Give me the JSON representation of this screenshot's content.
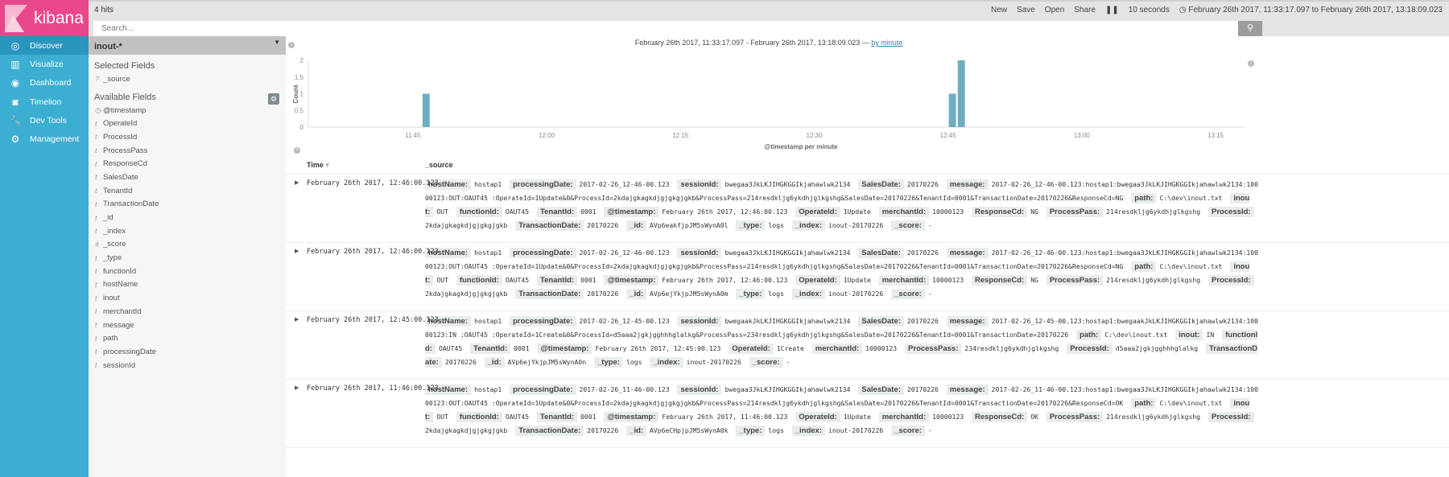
{
  "app": {
    "logo_text": "kibana"
  },
  "nav": [
    {
      "label": "Discover",
      "icon": "compass-icon",
      "glyph": "◎"
    },
    {
      "label": "Visualize",
      "icon": "bar-chart-icon",
      "glyph": "▥"
    },
    {
      "label": "Dashboard",
      "icon": "dashboard-icon",
      "glyph": "◉"
    },
    {
      "label": "Timelion",
      "icon": "timelion-icon",
      "glyph": "◙"
    },
    {
      "label": "Dev Tools",
      "icon": "wrench-icon",
      "glyph": "🔧"
    },
    {
      "label": "Management",
      "icon": "gear-icon",
      "glyph": "⚙"
    }
  ],
  "topbar": {
    "hits": "4 hits",
    "menu": [
      "New",
      "Save",
      "Open",
      "Share"
    ],
    "pause_glyph": "❚❚",
    "refresh": "10 seconds",
    "time_range": "February 26th 2017, 11:33:17.097 to February 26th 2017, 13:18:09.023"
  },
  "search": {
    "placeholder": "Search..."
  },
  "sidebar": {
    "index_pattern": "inout-*",
    "selected_title": "Selected Fields",
    "selected": [
      {
        "type": "?",
        "name": "_source"
      }
    ],
    "available_title": "Available Fields",
    "available": [
      {
        "type": "◷",
        "name": "@timestamp"
      },
      {
        "type": "t",
        "name": "OperateId"
      },
      {
        "type": "t",
        "name": "ProcessId"
      },
      {
        "type": "t",
        "name": "ProcessPass"
      },
      {
        "type": "t",
        "name": "ResponseCd"
      },
      {
        "type": "t",
        "name": "SalesDate"
      },
      {
        "type": "t",
        "name": "TenantId"
      },
      {
        "type": "t",
        "name": "TransactionDate"
      },
      {
        "type": "t",
        "name": "_id"
      },
      {
        "type": "t",
        "name": "_index"
      },
      {
        "type": "#",
        "name": "_score"
      },
      {
        "type": "t",
        "name": "_type"
      },
      {
        "type": "t",
        "name": "functionId"
      },
      {
        "type": "t",
        "name": "hostName"
      },
      {
        "type": "t",
        "name": "inout"
      },
      {
        "type": "t",
        "name": "merchantId"
      },
      {
        "type": "t",
        "name": "message"
      },
      {
        "type": "t",
        "name": "path"
      },
      {
        "type": "t",
        "name": "processingDate"
      },
      {
        "type": "t",
        "name": "sessionId"
      }
    ]
  },
  "chart_header": {
    "range": "February 26th 2017, 11:33:17.097 - February 26th 2017, 13:18:09.023 — ",
    "interval_link": "by minute"
  },
  "chart_data": {
    "type": "bar",
    "xlabel": "@timestamp per minute",
    "ylabel": "Count",
    "ylim": [
      0,
      2
    ],
    "yticks": [
      "0",
      "0.5",
      "1",
      "1.5",
      "2"
    ],
    "xlim": [
      "11:33:17",
      "13:18:09"
    ],
    "xticks": [
      "11:45",
      "12:00",
      "12:15",
      "12:30",
      "12:45",
      "13:00",
      "13:15"
    ],
    "bar_color": "#6eadc1",
    "x": [
      "11:46",
      "12:45",
      "12:46"
    ],
    "values": [
      1,
      1,
      2
    ]
  },
  "table": {
    "col_time": "Time",
    "col_source": "_source",
    "sort_glyph": "▾"
  },
  "documents": [
    {
      "time": "February 26th 2017, 12:46:00.123",
      "fields": [
        [
          "hostName:",
          "hostap1"
        ],
        [
          "processingDate:",
          "2017-02-26_12-46-00.123"
        ],
        [
          "sessionId:",
          "bwegaa3JkLKJIHGKGGIkjahawlwk2134"
        ],
        [
          "SalesDate:",
          "20170226"
        ],
        [
          "message:",
          "2017-02-26_12-46-00.123:hostap1:bwegaa3JkLKJIHGKGGIkjahawlwk2134:10000123:OUT:OAUT45 :OperateId=1Update&0&ProcessId=2kdajgkagkdjgjgkgjgkb&ProcessPass=214resdkljg6ykdhjglkgshg&SalesDate=20170226&TenantId=0001&TransactionDate=20170226&ResponseCd=NG"
        ],
        [
          "path:",
          "C:\\dev\\inout.txt"
        ],
        [
          "inout:",
          "OUT"
        ],
        [
          "functionId:",
          "OAUT45"
        ],
        [
          "TenantId:",
          "0001"
        ],
        [
          "@timestamp:",
          "February 26th 2017, 12:46:00.123"
        ],
        [
          "OperateId:",
          "1Update"
        ],
        [
          "merchantId:",
          "10000123"
        ],
        [
          "ResponseCd:",
          "NG"
        ],
        [
          "ProcessPass:",
          "214resdkljg6ykdhjglkgshg"
        ],
        [
          "ProcessId:",
          "2kdajgkagkdjgjgkgjgkb"
        ],
        [
          "TransactionDate:",
          "20170226"
        ],
        [
          "_id:",
          "AVp6eakfjpJM5sWynA0l"
        ],
        [
          "_type:",
          "logs"
        ],
        [
          "_index:",
          "inout-20170226"
        ],
        [
          "_score:",
          "-"
        ]
      ]
    },
    {
      "time": "February 26th 2017, 12:46:00.123",
      "fields": [
        [
          "hostName:",
          "hostap1"
        ],
        [
          "processingDate:",
          "2017-02-26_12-46-00.123"
        ],
        [
          "sessionId:",
          "bwegaa3JkLKJIHGKGGIkjahawlwk2134"
        ],
        [
          "SalesDate:",
          "20170226"
        ],
        [
          "message:",
          "2017-02-26_12-46-00.123:hostap1:bwegaa3JkLKJIHGKGGIkjahawlwk2134:10000123:OUT:OAUT45 :OperateId=1Update&0&ProcessId=2kdajgkagkdjgjgkgjgkb&ProcessPass=214resdkljg6ykdhjglkgshg&SalesDate=20170226&TenantId=0001&TransactionDate=20170226&ResponseCd=NG"
        ],
        [
          "path:",
          "C:\\dev\\inout.txt"
        ],
        [
          "inout:",
          "OUT"
        ],
        [
          "functionId:",
          "OAUT45"
        ],
        [
          "TenantId:",
          "0001"
        ],
        [
          "@timestamp:",
          "February 26th 2017, 12:46:00.123"
        ],
        [
          "OperateId:",
          "1Update"
        ],
        [
          "merchantId:",
          "10000123"
        ],
        [
          "ResponseCd:",
          "NG"
        ],
        [
          "ProcessPass:",
          "214resdkljg6ykdhjglkgshg"
        ],
        [
          "ProcessId:",
          "2kdajgkagkdjgjgkgjgkb"
        ],
        [
          "TransactionDate:",
          "20170226"
        ],
        [
          "_id:",
          "AVp6ejYkjpJM5sWynA0m"
        ],
        [
          "_type:",
          "logs"
        ],
        [
          "_index:",
          "inout-20170226"
        ],
        [
          "_score:",
          "-"
        ]
      ]
    },
    {
      "time": "February 26th 2017, 12:45:00.123",
      "fields": [
        [
          "hostName:",
          "hostap1"
        ],
        [
          "processingDate:",
          "2017-02-26_12-45-00.123"
        ],
        [
          "sessionId:",
          "bwegaakJkLKJIHGKGGIkjahawlwk2134"
        ],
        [
          "SalesDate:",
          "20170226"
        ],
        [
          "message:",
          "2017-02-26_12-45-00.123:hostap1:bwegaakJkLKJIHGKGGIkjahawlwk2134:10000123:IN :OAUT45 :OperateId=1Create&0&ProcessId=d5aaa2jgkjgghhhglalkg&ProcessPass=234resdkljg6ykdhjglkgshg&SalesDate=20170226&TenantId=0001&TransactionDate=20170226"
        ],
        [
          "path:",
          "C:\\dev\\inout.txt"
        ],
        [
          "inout:",
          "IN"
        ],
        [
          "functionId:",
          "OAUT45"
        ],
        [
          "TenantId:",
          "0001"
        ],
        [
          "@timestamp:",
          "February 26th 2017, 12:45:00.123"
        ],
        [
          "OperateId:",
          "1Create"
        ],
        [
          "merchantId:",
          "10000123"
        ],
        [
          "ProcessPass:",
          "234resdkljg6ykdhjglkgshg"
        ],
        [
          "ProcessId:",
          "d5aaa2jgkjgghhhglalkg"
        ],
        [
          "TransactionDate:",
          "20170226"
        ],
        [
          "_id:",
          "AVp6ejYkjpJM5sWynA0n"
        ],
        [
          "_type:",
          "logs"
        ],
        [
          "_index:",
          "inout-20170226"
        ],
        [
          "_score:",
          "-"
        ]
      ]
    },
    {
      "time": "February 26th 2017, 11:46:00.123",
      "fields": [
        [
          "hostName:",
          "hostap1"
        ],
        [
          "processingDate:",
          "2017-02-26_11-46-00.123"
        ],
        [
          "sessionId:",
          "bwegaa3JkLKJIHGKGGIkjahawlwk2134"
        ],
        [
          "SalesDate:",
          "20170226"
        ],
        [
          "message:",
          "2017-02-26_11-46-00.123:hostap1:bwegaa3JkLKJIHGKGGIkjahawlwk2134:10000123:OUT:OAUT45 :OperateId=1Update&0&ProcessId=2kdajgkagkdjgjgkgjgkb&ProcessPass=214resdkljg6ykdhjglkgshg&SalesDate=20170226&TenantId=0001&TransactionDate=20170226&ResponseCd=OK"
        ],
        [
          "path:",
          "C:\\dev\\inout.txt"
        ],
        [
          "inout:",
          "OUT"
        ],
        [
          "functionId:",
          "OAUT45"
        ],
        [
          "TenantId:",
          "0001"
        ],
        [
          "@timestamp:",
          "February 26th 2017, 11:46:00.123"
        ],
        [
          "OperateId:",
          "1Update"
        ],
        [
          "merchantId:",
          "10000123"
        ],
        [
          "ResponseCd:",
          "OK"
        ],
        [
          "ProcessPass:",
          "214resdkljg6ykdhjglkgshg"
        ],
        [
          "ProcessId:",
          "2kdajgkagkdjgjgkgjgkb"
        ],
        [
          "TransactionDate:",
          "20170226"
        ],
        [
          "_id:",
          "AVp6eCHpjpJM5sWynA0k"
        ],
        [
          "_type:",
          "logs"
        ],
        [
          "_index:",
          "inout-20170226"
        ],
        [
          "_score:",
          "-"
        ]
      ]
    }
  ]
}
